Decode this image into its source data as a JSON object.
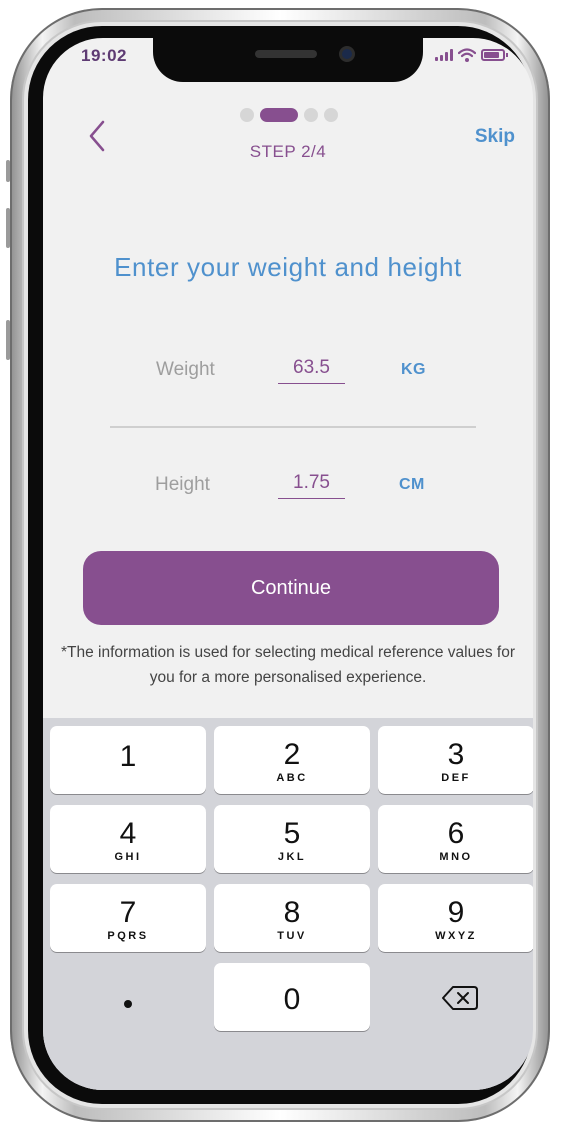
{
  "status_bar": {
    "time": "19:02",
    "signal_icon": "cellular-signal-icon",
    "wifi_icon": "wifi-icon",
    "battery_icon": "battery-icon"
  },
  "header": {
    "back_icon": "chevron-left-icon",
    "step_indicator": {
      "total": 4,
      "current": 2
    },
    "step_label": "STEP 2/4",
    "skip_label": "Skip"
  },
  "title": "Enter your weight and height",
  "measurements": {
    "weight": {
      "label": "Weight",
      "value": "63.5",
      "unit": "KG"
    },
    "height": {
      "label": "Height",
      "value": "1.75",
      "unit": "CM"
    }
  },
  "continue_label": "Continue",
  "disclaimer": "*The information is used for selecting medical reference values for you for a more personalised experience.",
  "keypad": {
    "keys": [
      {
        "digit": "1",
        "letters": ""
      },
      {
        "digit": "2",
        "letters": "ABC"
      },
      {
        "digit": "3",
        "letters": "DEF"
      },
      {
        "digit": "4",
        "letters": "GHI"
      },
      {
        "digit": "5",
        "letters": "JKL"
      },
      {
        "digit": "6",
        "letters": "MNO"
      },
      {
        "digit": "7",
        "letters": "PQRS"
      },
      {
        "digit": "8",
        "letters": "TUV"
      },
      {
        "digit": "9",
        "letters": "WXYZ"
      },
      {
        "digit": "0",
        "letters": ""
      }
    ],
    "decimal_key": "decimal-point-key",
    "delete_icon": "backspace-icon"
  },
  "colors": {
    "brand_purple": "#874f8f",
    "accent_blue": "#4f91cd",
    "screen_background": "#f1f1f1",
    "keypad_background": "#d3d4d9"
  }
}
